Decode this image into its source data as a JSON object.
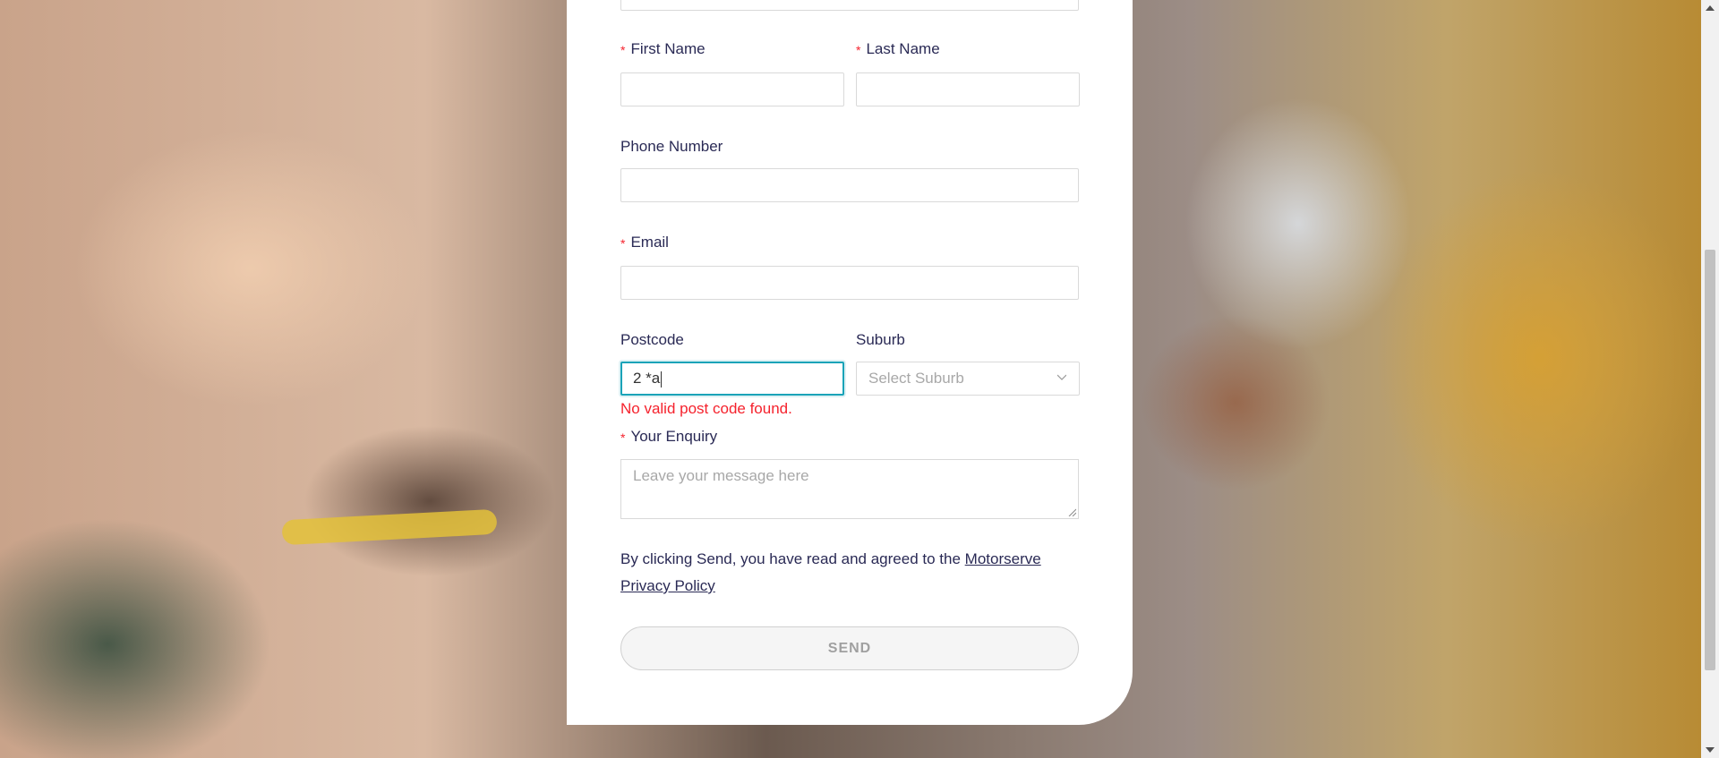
{
  "form": {
    "first_name": {
      "label": "First Name",
      "value": ""
    },
    "last_name": {
      "label": "Last Name",
      "value": ""
    },
    "phone": {
      "label": "Phone Number",
      "value": ""
    },
    "email": {
      "label": "Email",
      "value": ""
    },
    "postcode": {
      "label": "Postcode",
      "value": "2 *a",
      "error": "No valid post code found."
    },
    "suburb": {
      "label": "Suburb",
      "placeholder": "Select Suburb"
    },
    "enquiry": {
      "label": "Your Enquiry",
      "placeholder": "Leave your message here"
    },
    "required_marker": "*",
    "consent_text": "By clicking Send, you have read and agreed to the ",
    "privacy_link": "Motorserve Privacy Policy",
    "send_label": "SEND"
  },
  "colors": {
    "accent": "#1aa3b8",
    "error": "#f5222d",
    "text": "#2a2a55"
  }
}
